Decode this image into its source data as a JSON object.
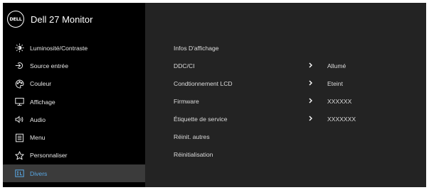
{
  "header": {
    "logo_text": "DELL",
    "title": "Dell 27 Monitor"
  },
  "sidebar": {
    "items": [
      {
        "label": "Luminosité/Contraste",
        "icon": "brightness-icon"
      },
      {
        "label": "Source entrée",
        "icon": "input-source-icon"
      },
      {
        "label": "Couleur",
        "icon": "color-palette-icon"
      },
      {
        "label": "Affichage",
        "icon": "display-icon"
      },
      {
        "label": "Audio",
        "icon": "speaker-icon"
      },
      {
        "label": "Menu",
        "icon": "menu-icon"
      },
      {
        "label": "Personnaliser",
        "icon": "star-icon"
      },
      {
        "label": "Divers",
        "icon": "others-icon",
        "selected": true
      }
    ]
  },
  "content": {
    "rows": [
      {
        "label": "Infos D'affichage"
      },
      {
        "label": "DDC/CI",
        "value": "Allumé"
      },
      {
        "label": "Condtionnement LCD",
        "value": "Eteint"
      },
      {
        "label": "Firmware",
        "value": "XXXXXX"
      },
      {
        "label": "Étiquette de service",
        "value": "XXXXXXX"
      },
      {
        "label": "Réinit. autres"
      },
      {
        "label": "Réinitialisation"
      }
    ]
  },
  "colors": {
    "sidebar_bg": "#000000",
    "content_bg": "#232323",
    "selected_bg": "#3b3b3b",
    "accent": "#5aa9e6",
    "text": "#e6e6e6"
  }
}
